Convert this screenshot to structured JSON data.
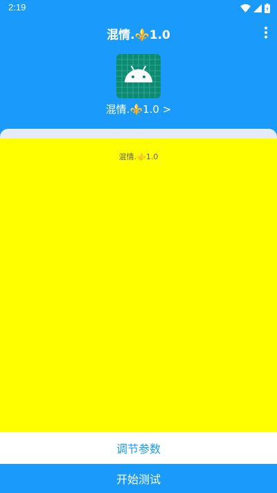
{
  "status_bar": {
    "time": "2:19",
    "icons": [
      "wifi-icon",
      "signal-icon",
      "battery-icon"
    ]
  },
  "app_bar": {
    "title": "混情.⚜️1.0",
    "menu_icon": "more-vert-icon"
  },
  "header": {
    "app_icon": "android-icon",
    "link_label": "混情.⚜️1.0 >"
  },
  "content": {
    "caption": "混情.⚜️1.0"
  },
  "buttons": {
    "adjust_label": "调节参数",
    "start_label": "开始测试"
  },
  "colors": {
    "primary": "#1a9bfc",
    "content_bg": "#ffff00",
    "card_outline": "#e6ebf8",
    "icon_bg": "#0c8b73"
  }
}
